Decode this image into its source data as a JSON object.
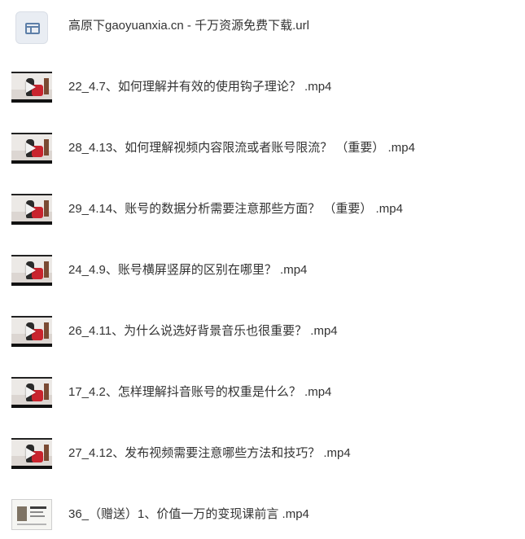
{
  "files": [
    {
      "name": "高原下gaoyuanxia.cn - 千万资源免费下载.url",
      "type": "url",
      "icon": "url-shortcut-icon"
    },
    {
      "name": "22_4.7、如何理解并有效的使用钩子理论？ .mp4",
      "type": "video",
      "icon": "video-thumbnail"
    },
    {
      "name": "28_4.13、如何理解视频内容限流或者账号限流？ （重要） .mp4",
      "type": "video",
      "icon": "video-thumbnail"
    },
    {
      "name": "29_4.14、账号的数据分析需要注意那些方面？ （重要） .mp4",
      "type": "video",
      "icon": "video-thumbnail"
    },
    {
      "name": "24_4.9、账号横屏竖屏的区别在哪里？ .mp4",
      "type": "video",
      "icon": "video-thumbnail"
    },
    {
      "name": "26_4.11、为什么说选好背景音乐也很重要？ .mp4",
      "type": "video",
      "icon": "video-thumbnail"
    },
    {
      "name": "17_4.2、怎样理解抖音账号的权重是什么？ .mp4",
      "type": "video",
      "icon": "video-thumbnail"
    },
    {
      "name": "27_4.12、发布视频需要注意哪些方法和技巧？ .mp4",
      "type": "video",
      "icon": "video-thumbnail"
    },
    {
      "name": "36_（赠送）1、价值一万的变现课前言 .mp4",
      "type": "video",
      "icon": "video-thumbnail-document"
    }
  ]
}
